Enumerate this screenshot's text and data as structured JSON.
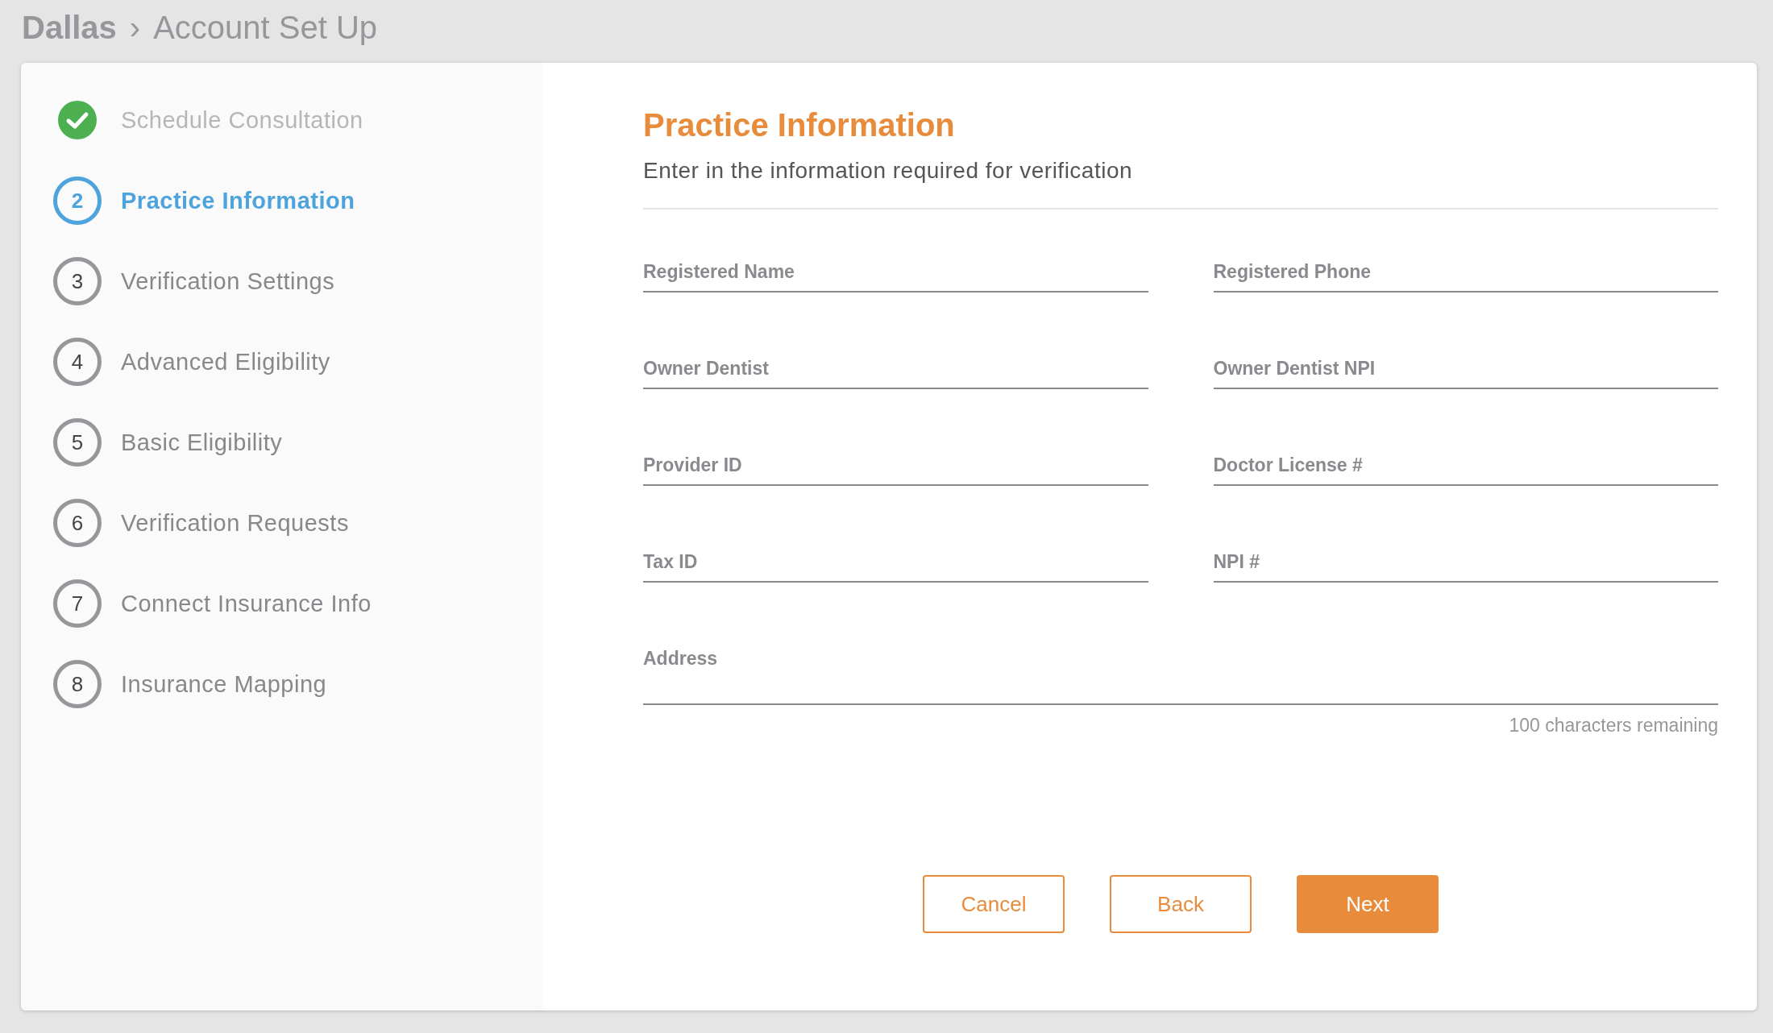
{
  "breadcrumb": {
    "parent": "Dallas",
    "separator": "›",
    "current": "Account Set Up"
  },
  "steps": [
    {
      "label": "Schedule Consultation",
      "completed": true,
      "selected": false
    },
    {
      "number": "2",
      "label": "Practice Information",
      "completed": false,
      "selected": true
    },
    {
      "number": "3",
      "label": "Verification Settings",
      "completed": false,
      "selected": false
    },
    {
      "number": "4",
      "label": "Advanced Eligibility",
      "completed": false,
      "selected": false
    },
    {
      "number": "5",
      "label": "Basic Eligibility",
      "completed": false,
      "selected": false
    },
    {
      "number": "6",
      "label": "Verification Requests",
      "completed": false,
      "selected": false
    },
    {
      "number": "7",
      "label": "Connect Insurance Info",
      "completed": false,
      "selected": false
    },
    {
      "number": "8",
      "label": "Insurance Mapping",
      "completed": false,
      "selected": false
    }
  ],
  "form": {
    "title": "Practice Information",
    "subtitle": "Enter in the information required for verification",
    "fields": [
      {
        "placeholder": "Registered Name",
        "kind": "half"
      },
      {
        "placeholder": "Registered Phone",
        "kind": "half"
      },
      {
        "placeholder": "Owner Dentist",
        "kind": "half"
      },
      {
        "placeholder": "Owner Dentist NPI",
        "kind": "half"
      },
      {
        "placeholder": "Provider ID",
        "kind": "half"
      },
      {
        "placeholder": "Doctor License #",
        "kind": "half"
      },
      {
        "placeholder": "Tax ID",
        "kind": "half"
      },
      {
        "placeholder": "NPI #",
        "kind": "half"
      },
      {
        "placeholder": "Address",
        "kind": "full",
        "helper": "100 characters remaining"
      }
    ],
    "buttons": [
      {
        "label": "Cancel",
        "kind": "outline"
      },
      {
        "label": "Back",
        "kind": "outline"
      },
      {
        "label": "Next",
        "kind": "primary"
      }
    ]
  }
}
